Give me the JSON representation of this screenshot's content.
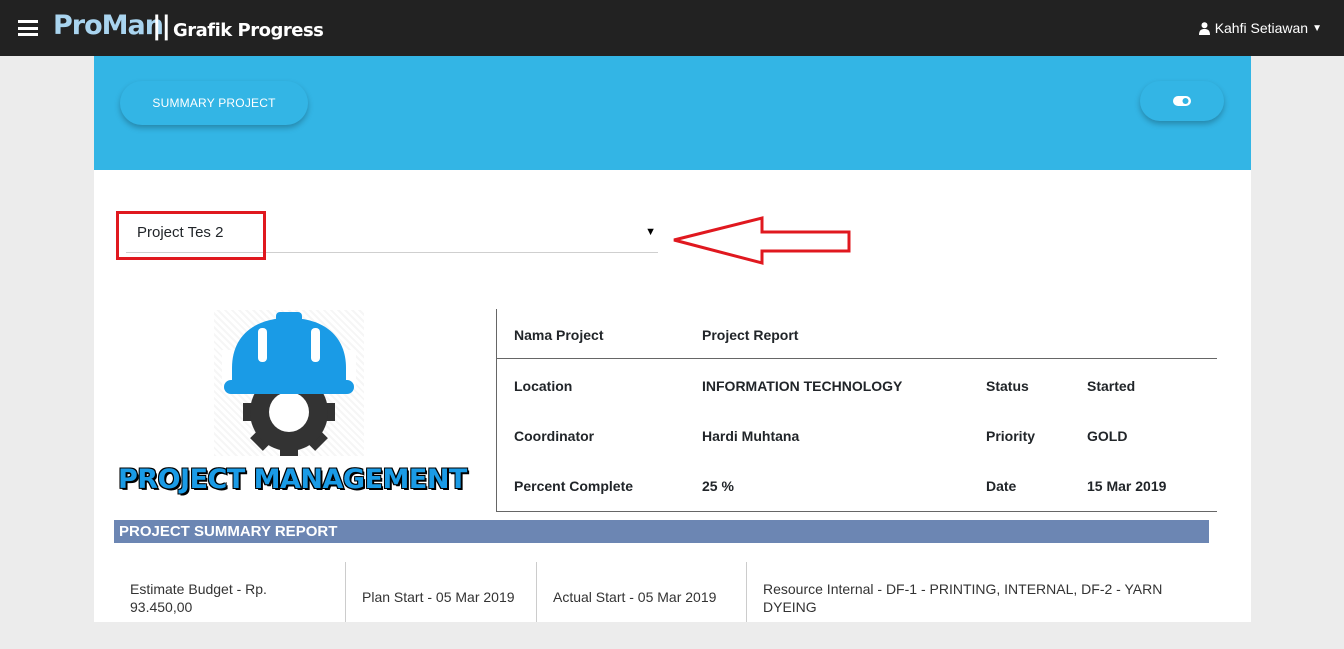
{
  "navbar": {
    "brand": "ProMan",
    "separator": "||",
    "subtitle": "Grafik Progress",
    "user_name": "Kahfi Setiawan",
    "menu_icon": "hamburger-icon",
    "user_icon": "user-icon"
  },
  "banner": {
    "summary_button": "SUMMARY PROJECT",
    "toggle_icon": "toggle-icon"
  },
  "project_select": {
    "value": "Project Tes 2"
  },
  "logo": {
    "title": "PROJECT MANAGEMENT"
  },
  "info": {
    "nama_label": "Nama Project",
    "nama_value": "Project Report",
    "location_label": "Location",
    "location_value": "INFORMATION TECHNOLOGY",
    "status_label": "Status",
    "status_value": "Started",
    "coordinator_label": "Coordinator",
    "coordinator_value": "Hardi Muhtana",
    "priority_label": "Priority",
    "priority_value": "GOLD",
    "percent_label": "Percent Complete",
    "percent_value": "25 %",
    "date_label": "Date",
    "date_value": "15 Mar 2019"
  },
  "summary": {
    "title": "PROJECT SUMMARY REPORT",
    "budget": "Estimate Budget - Rp. 93.450,00",
    "plan_start": "Plan Start - 05 Mar 2019",
    "actual_start": "Actual Start - 05 Mar 2019",
    "resource": "Resource Internal - DF-1 - PRINTING, INTERNAL, DF-2 - YARN DYEING"
  },
  "colors": {
    "navbar": "#222222",
    "banner": "#33b5e5",
    "summary_bar": "#6c86b3",
    "highlight": "#e0181f",
    "helmet": "#1a9be6",
    "gear": "#333333"
  }
}
